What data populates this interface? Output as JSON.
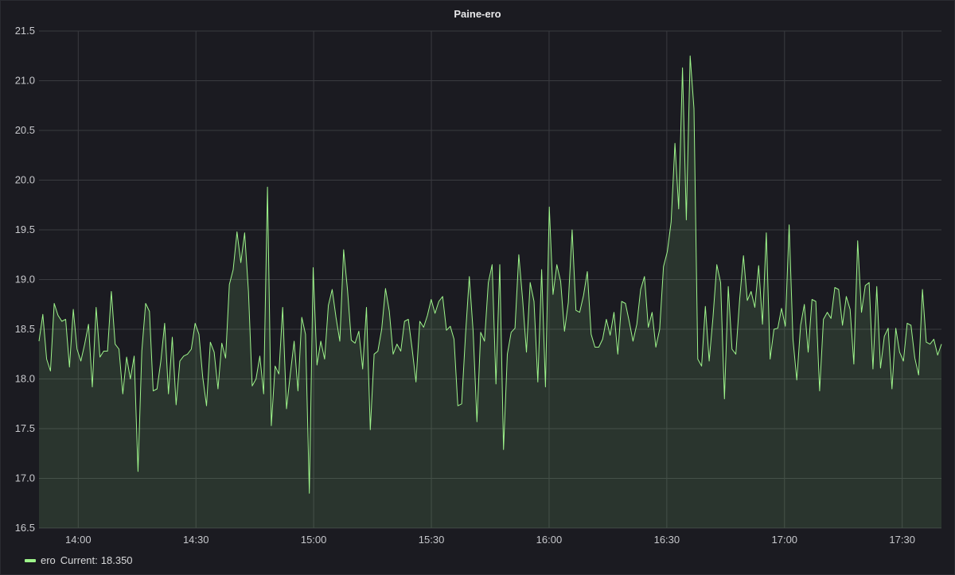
{
  "panel": {
    "title": "Paine-ero"
  },
  "legend": {
    "series_name": "ero",
    "current_label": "Current:",
    "current_value": "18.350"
  },
  "colors": {
    "line": "#9ef58b",
    "fill": "#9ef58b",
    "grid": "#3a3b40",
    "background": "#1b1b21"
  },
  "chart_data": {
    "type": "line",
    "title": "Paine-ero",
    "xlabel": "",
    "ylabel": "",
    "xlim": [
      "13:50",
      "17:40"
    ],
    "ylim": [
      16.5,
      21.5
    ],
    "y_ticks": [
      "16.5",
      "17.0",
      "17.5",
      "18.0",
      "18.5",
      "19.0",
      "19.5",
      "20.0",
      "20.5",
      "21.0",
      "21.5"
    ],
    "x_ticks": [
      "14:00",
      "14:30",
      "15:00",
      "15:30",
      "16:00",
      "16:30",
      "17:00",
      "17:30"
    ],
    "grid": true,
    "legend": "bottom-left",
    "series": [
      {
        "name": "ero",
        "current": 18.35,
        "x_start": "13:50",
        "x_end": "17:40",
        "values": [
          18.38,
          18.65,
          18.2,
          18.08,
          18.76,
          18.64,
          18.58,
          18.6,
          18.12,
          18.7,
          18.3,
          18.18,
          18.35,
          18.55,
          17.92,
          18.72,
          18.22,
          18.28,
          18.28,
          18.88,
          18.35,
          18.3,
          17.85,
          18.22,
          18.0,
          18.23,
          17.07,
          18.28,
          18.76,
          18.68,
          17.88,
          17.9,
          18.18,
          18.56,
          17.85,
          18.42,
          17.74,
          18.18,
          18.23,
          18.25,
          18.3,
          18.56,
          18.45,
          18.02,
          17.73,
          18.37,
          18.27,
          17.9,
          18.36,
          18.21,
          18.95,
          19.1,
          19.48,
          19.17,
          19.47,
          18.88,
          17.93,
          18.0,
          18.23,
          17.85,
          19.93,
          17.53,
          18.13,
          18.05,
          18.72,
          17.7,
          18.05,
          18.38,
          17.88,
          18.62,
          18.45,
          16.85,
          19.12,
          18.14,
          18.38,
          18.2,
          18.74,
          18.9,
          18.62,
          18.38,
          19.3,
          18.9,
          18.39,
          18.36,
          18.48,
          18.1,
          18.72,
          17.49,
          18.25,
          18.28,
          18.5,
          18.91,
          18.68,
          18.25,
          18.35,
          18.28,
          18.58,
          18.6,
          18.3,
          17.97,
          18.58,
          18.52,
          18.64,
          18.8,
          18.66,
          18.78,
          18.83,
          18.49,
          18.53,
          18.4,
          17.73,
          17.75,
          18.44,
          19.03,
          18.48,
          17.57,
          18.47,
          18.38,
          18.97,
          19.15,
          17.95,
          19.15,
          17.29,
          18.25,
          18.47,
          18.51,
          19.25,
          18.8,
          18.27,
          18.97,
          18.78,
          17.97,
          19.1,
          17.92,
          19.73,
          18.85,
          19.15,
          18.98,
          18.48,
          18.77,
          19.5,
          18.69,
          18.67,
          18.84,
          19.08,
          18.45,
          18.32,
          18.32,
          18.4,
          18.6,
          18.44,
          18.67,
          18.25,
          18.78,
          18.76,
          18.58,
          18.38,
          18.55,
          18.9,
          19.03,
          18.52,
          18.67,
          18.32,
          18.5,
          19.13,
          19.28,
          19.58,
          20.37,
          19.71,
          21.13,
          19.6,
          21.25,
          20.72,
          18.2,
          18.13,
          18.73,
          18.18,
          18.62,
          19.15,
          18.97,
          17.8,
          18.93,
          18.3,
          18.25,
          18.8,
          19.24,
          18.79,
          18.88,
          18.72,
          19.14,
          18.55,
          19.47,
          18.2,
          18.5,
          18.51,
          18.71,
          18.53,
          19.55,
          18.4,
          17.99,
          18.54,
          18.75,
          18.27,
          18.8,
          18.78,
          17.88,
          18.6,
          18.67,
          18.61,
          18.92,
          18.9,
          18.54,
          18.83,
          18.7,
          18.15,
          19.39,
          18.67,
          18.94,
          18.97,
          18.1,
          18.93,
          18.11,
          18.43,
          18.51,
          17.9,
          18.51,
          18.27,
          18.18,
          18.56,
          18.54,
          18.21,
          18.04,
          18.9,
          18.37,
          18.35,
          18.4,
          18.24,
          18.35
        ]
      }
    ]
  }
}
